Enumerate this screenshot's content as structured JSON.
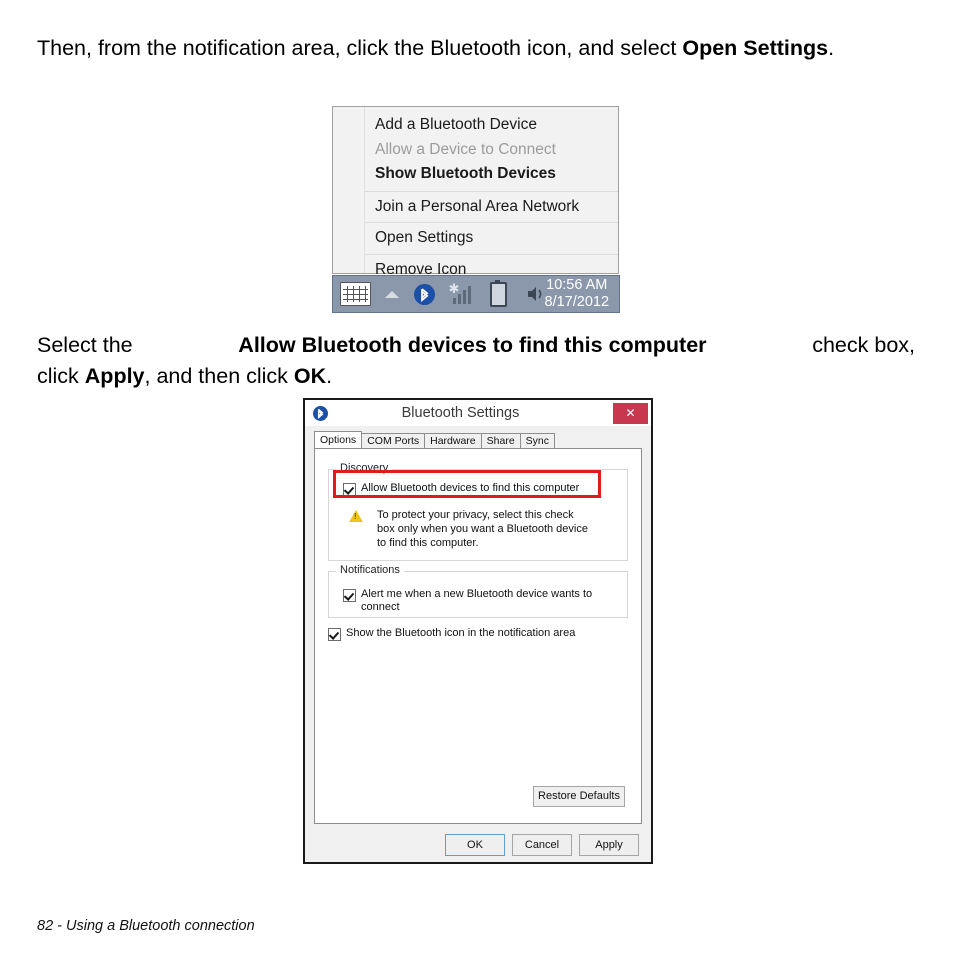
{
  "paragraphs": {
    "p1_part1": "Then, from the notification area, click the Bluetooth icon, and select ",
    "p1_bold": "Open Settings",
    "p1_part2": ".",
    "p2_l1_a": "Select the ",
    "p2_l1_bold": "Allow Bluetooth devices to find this computer",
    "p2_l1_b": " check box,",
    "p2_l2_a": "click ",
    "p2_l2_bold1": "Apply",
    "p2_l2_b": ", and then click ",
    "p2_l2_bold2": "OK",
    "p2_l2_c": "."
  },
  "context_menu": {
    "items": [
      {
        "label": "Add a Bluetooth Device",
        "state": "normal"
      },
      {
        "label": "Allow a Device to Connect",
        "state": "disabled"
      },
      {
        "label": "Show Bluetooth Devices",
        "state": "bold"
      },
      {
        "label": "Join a Personal Area Network",
        "state": "normal"
      },
      {
        "label": "Open Settings",
        "state": "normal"
      },
      {
        "label": "Remove Icon",
        "state": "normal"
      }
    ]
  },
  "taskbar": {
    "icons": [
      "keyboard-icon",
      "show-hidden-icons-chevron-icon",
      "bluetooth-icon",
      "wireless-signal-icon",
      "battery-icon",
      "volume-speaker-icon"
    ],
    "time": "10:56 AM",
    "date": "8/17/2012",
    "background_color": "#8b98ab",
    "text_color": "#ffffff"
  },
  "dialog": {
    "title": "Bluetooth Settings",
    "title_icon": "bluetooth-icon",
    "close_label": "✕",
    "close_color": "#c7384f",
    "tabs": [
      {
        "label": "Options",
        "selected": true
      },
      {
        "label": "COM Ports",
        "selected": false
      },
      {
        "label": "Hardware",
        "selected": false
      },
      {
        "label": "Share",
        "selected": false
      },
      {
        "label": "Sync",
        "selected": false
      }
    ],
    "discovery": {
      "group_label": "Discovery",
      "checkbox_label": "Allow Bluetooth devices to find this computer",
      "checkbox_checked": "true",
      "warning_icon": "warning-triangle-icon",
      "warning_text": "To protect your privacy, select this check box only when you want a Bluetooth device to find this computer.",
      "highlight_color": "#e01b1b"
    },
    "notifications": {
      "group_label": "Notifications",
      "checkbox_label": "Alert me when a new Bluetooth device wants to connect",
      "checkbox_checked": "true"
    },
    "show_icon": {
      "checkbox_label": "Show the Bluetooth icon in the notification area",
      "checkbox_checked": "true"
    },
    "buttons": {
      "restore_defaults": "Restore Defaults",
      "ok": "OK",
      "cancel": "Cancel",
      "apply": "Apply"
    }
  },
  "page_footer": "82 - Using a Bluetooth connection"
}
